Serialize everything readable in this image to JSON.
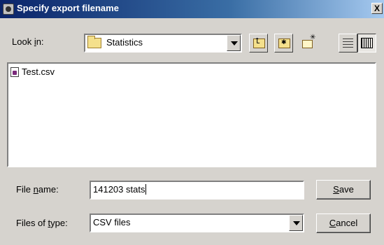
{
  "window": {
    "title": "Specify export filename",
    "close_label": "X"
  },
  "lookin": {
    "label_pre": "Look ",
    "label_accel": "i",
    "label_post": "n:",
    "folder": "Statistics"
  },
  "files": [
    {
      "name": "Test.csv",
      "icon": "csv-file-icon"
    }
  ],
  "filename": {
    "label_pre": "File ",
    "label_accel": "n",
    "label_post": "ame:",
    "value": "141203 stats"
  },
  "filetype": {
    "label_pre": "Files of ",
    "label_accel": "t",
    "label_post": "ype:",
    "value": "CSV files"
  },
  "buttons": {
    "save_accel": "S",
    "save_rest": "ave",
    "cancel_accel": "C",
    "cancel_rest": "ancel"
  },
  "colors": {
    "titlebar_start": "#0a246a",
    "titlebar_end": "#a6caf0",
    "dialog_bg": "#d6d3ce"
  }
}
